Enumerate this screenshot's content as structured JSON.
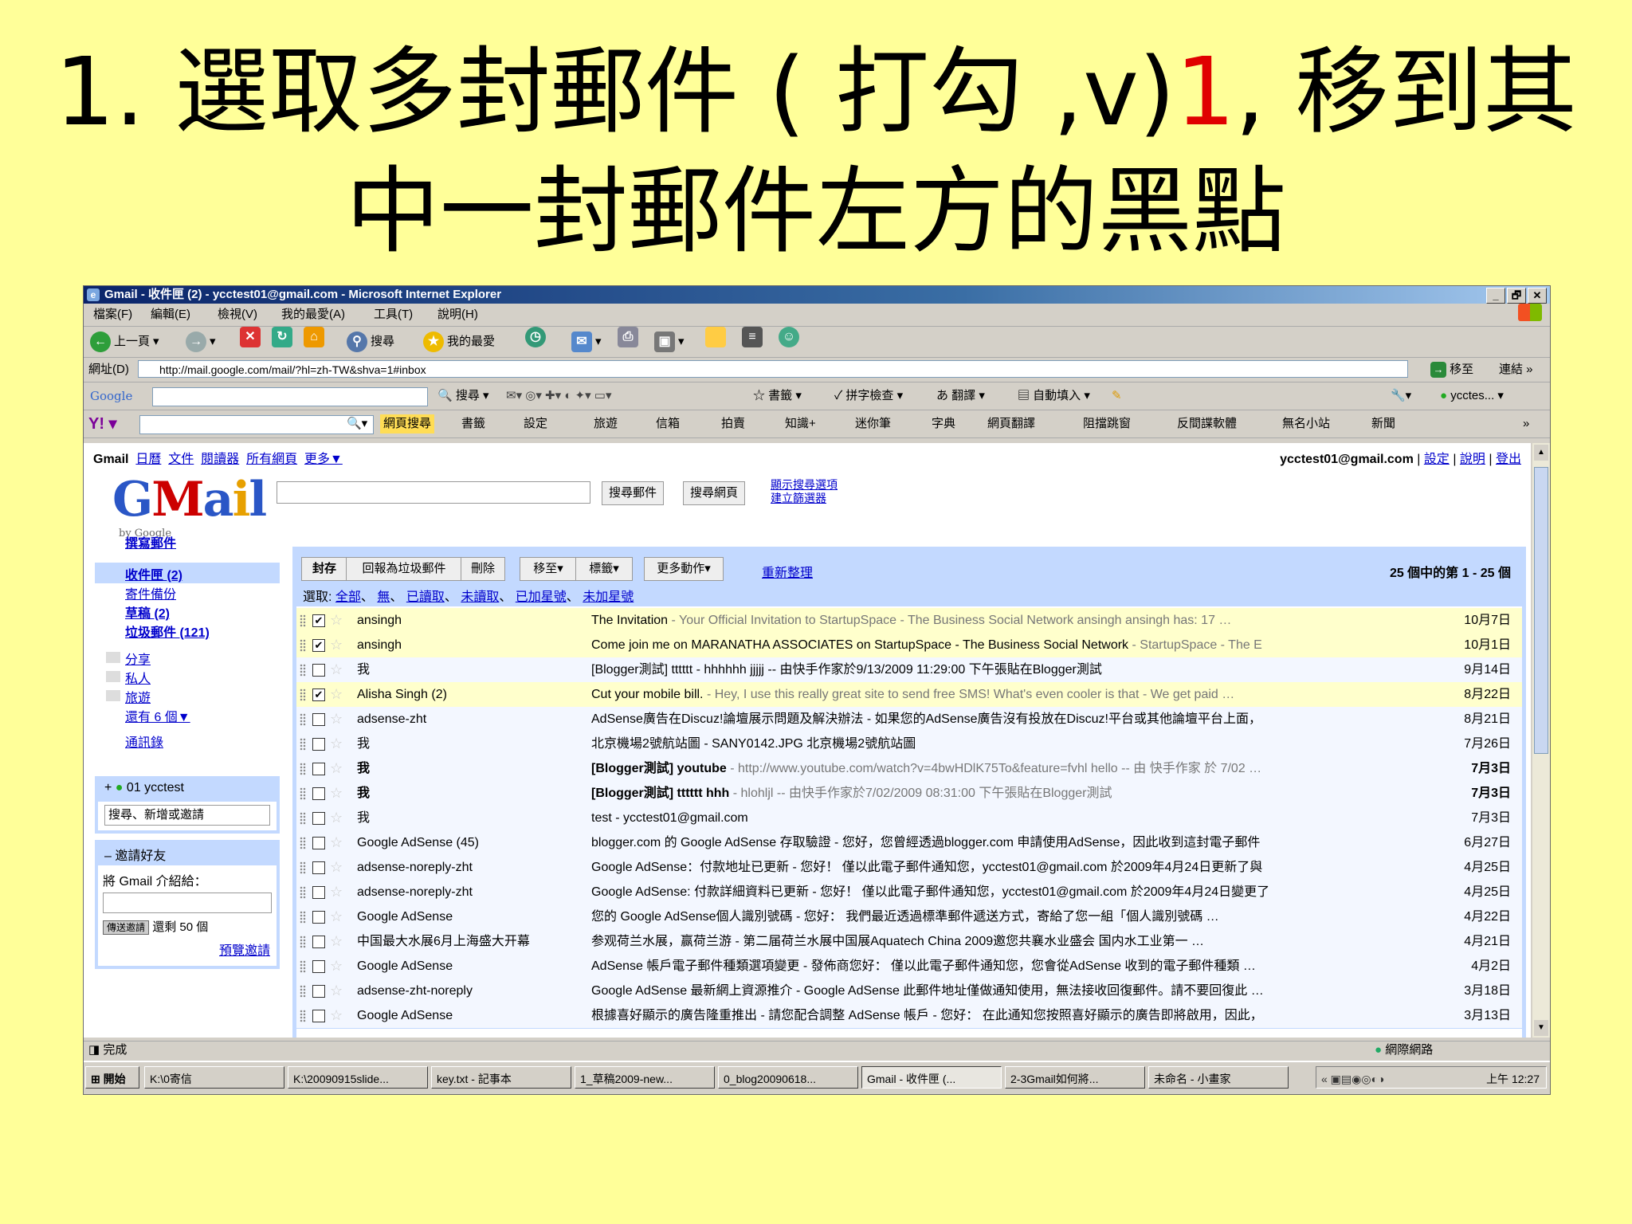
{
  "slide": {
    "title_line1_a": "1. 選取多封郵件 ( 打勾 ,v)",
    "title_line1_num": "1",
    "title_line1_b": ", 移到其",
    "title_line2": "中一封郵件左方的黑點"
  },
  "window": {
    "title": "Gmail - 收件匣 (2) - ycctest01@gmail.com - Microsoft Internet Explorer",
    "controls": [
      "_",
      "🗗",
      "✕"
    ]
  },
  "menu": [
    "檔案(F)",
    "編輯(E)",
    "檢視(V)",
    "我的最愛(A)",
    "工具(T)",
    "說明(H)"
  ],
  "toolbar": {
    "back": "上一頁",
    "search": "搜尋",
    "favorites": "我的最愛"
  },
  "address": {
    "label": "網址(D)",
    "url": "http://mail.google.com/mail/?hl=zh-TW&shva=1#inbox",
    "go": "移至",
    "links": "連結"
  },
  "google_toolbar": {
    "logo": "Google",
    "items": [
      "搜尋",
      "書籤",
      "拼字檢查",
      "翻譯",
      "自動填入"
    ],
    "account": "ycctes..."
  },
  "yahoo_toolbar": {
    "logo": "Y!",
    "items": [
      "網頁搜尋",
      "書籤",
      "設定",
      "旅遊",
      "信箱",
      "拍賣",
      "知識+",
      "迷你筆",
      "字典",
      "網頁翻譯",
      "阻擋跳窗",
      "反間諜軟體",
      "無名小站",
      "新聞"
    ]
  },
  "gmail": {
    "topnav": [
      "Gmail",
      "日曆",
      "文件",
      "閱讀器",
      "所有網頁",
      "更多▼"
    ],
    "account": "ycctest01@gmail.com",
    "account_links": [
      "設定",
      "說明",
      "登出"
    ],
    "logo": "Gmail",
    "logo_sub": "by Google",
    "search_mail_btn": "搜尋郵件",
    "search_web_btn": "搜尋網頁",
    "show_options": "顯示搜尋選項",
    "create_filter": "建立篩選器",
    "compose": "撰寫郵件",
    "nav": [
      "收件匣 (2)",
      "寄件備份",
      "草稿 (2)",
      "垃圾郵件 (121)"
    ],
    "labels": [
      "分享",
      "私人",
      "旅遊",
      "還有 6 個▼"
    ],
    "contacts": "通訊錄",
    "chat_user": "01 ycctest",
    "chat_search": "搜尋、新增或邀請",
    "invite_header": "邀請好友",
    "invite_text": "將 Gmail 介紹給：",
    "invite_btn": "傳送邀請",
    "invite_left": "還剩 50 個",
    "invite_preview": "預覽邀請",
    "actions": [
      "封存",
      "回報為垃圾郵件",
      "刪除",
      "移至▾",
      "標籤▾",
      "更多動作▾"
    ],
    "refresh": "重新整理",
    "count": "25 個中的第 1 - 25 個",
    "select_label": "選取:",
    "select_options": [
      "全部",
      "無",
      "已讀取",
      "未讀取",
      "已加星號",
      "未加星號"
    ],
    "rows": [
      {
        "checked": true,
        "unread": false,
        "sender": "ansingh",
        "subject": "The Invitation",
        "snippet": " - Your Official Invitation to StartupSpace - The Business Social Network ansingh ansingh has: 17 …",
        "date": "10月7日"
      },
      {
        "checked": true,
        "unread": false,
        "sender": "ansingh",
        "subject": "Come join me on MARANATHA ASSOCIATES on StartupSpace - The Business Social Network",
        "snippet": " - StartupSpace - The E",
        "date": "10月1日"
      },
      {
        "checked": false,
        "unread": false,
        "sender": "我",
        "subject": "",
        "snippet": "[Blogger測試] tttttt - hhhhhh jjjjj -- 由快手作家於9/13/2009 11:29:00 下午張貼在Blogger測試",
        "date": "9月14日"
      },
      {
        "checked": true,
        "unread": false,
        "sender": "Alisha Singh (2)",
        "subject": "Cut your mobile bill.",
        "snippet": " - Hey, I use this really great site to send free SMS! What's even cooler is that - We get paid …",
        "date": "8月22日"
      },
      {
        "checked": false,
        "unread": false,
        "sender": "adsense-zht",
        "subject": "",
        "snippet": "AdSense廣告在Discuz!論壇展示問題及解決辦法 - 如果您的AdSense廣告沒有投放在Discuz!平台或其他論壇平台上面，",
        "date": "8月21日"
      },
      {
        "checked": false,
        "unread": false,
        "sender": "我",
        "subject": "",
        "snippet": "北京機場2號航站圖 - SANY0142.JPG 北京機場2號航站圖",
        "date": "7月26日"
      },
      {
        "checked": false,
        "unread": true,
        "sender": "我",
        "subject": "[Blogger測試] youtube",
        "snippet": " - http://www.youtube.com/watch?v=4bwHDlK75To&feature=fvhl hello -- 由 快手作家 於 7/02 …",
        "date": "7月3日"
      },
      {
        "checked": false,
        "unread": true,
        "sender": "我",
        "subject": "[Blogger測試] tttttt hhh",
        "snippet": " - hlohljl -- 由快手作家於7/02/2009 08:31:00 下午張貼在Blogger測試",
        "date": "7月3日"
      },
      {
        "checked": false,
        "unread": false,
        "sender": "我",
        "subject": "",
        "snippet": "test - ycctest01@gmail.com",
        "date": "7月3日"
      },
      {
        "checked": false,
        "unread": false,
        "sender": "Google AdSense (45)",
        "subject": "",
        "snippet": "blogger.com 的 Google AdSense 存取驗證 - 您好，您曾經透過blogger.com 申請使用AdSense，因此收到這封電子郵件",
        "date": "6月27日"
      },
      {
        "checked": false,
        "unread": false,
        "sender": "adsense-noreply-zht",
        "subject": "",
        "snippet": "Google AdSense：付款地址已更新 - 您好！ 僅以此電子郵件通知您，ycctest01@gmail.com 於2009年4月24日更新了與",
        "date": "4月25日"
      },
      {
        "checked": false,
        "unread": false,
        "sender": "adsense-noreply-zht",
        "subject": "",
        "snippet": "Google AdSense: 付款詳細資料已更新 - 您好！ 僅以此電子郵件通知您，ycctest01@gmail.com 於2009年4月24日變更了",
        "date": "4月25日"
      },
      {
        "checked": false,
        "unread": false,
        "sender": "Google AdSense",
        "subject": "",
        "snippet": "您的 Google AdSense個人識別號碼 - 您好： 我們最近透過標準郵件遞送方式，寄給了您一組「個人識別號碼 …",
        "date": "4月22日"
      },
      {
        "checked": false,
        "unread": false,
        "sender": "中国最大水展6月上海盛大开幕",
        "subject": "",
        "snippet": "参观荷兰水展，赢荷兰游 - 第二届荷兰水展中国展Aquatech China 2009邀您共襄水业盛会 国内水工业第一 …",
        "date": "4月21日"
      },
      {
        "checked": false,
        "unread": false,
        "sender": "Google AdSense",
        "subject": "",
        "snippet": "AdSense 帳戶電子郵件種類選項變更 - 發佈商您好： 僅以此電子郵件通知您，您會從AdSense 收到的電子郵件種類 …",
        "date": "4月2日"
      },
      {
        "checked": false,
        "unread": false,
        "sender": "adsense-zht-noreply",
        "subject": "",
        "snippet": "Google AdSense 最新網上資源推介 - Google AdSense 此郵件地址僅做通知使用，無法接收回復郵件。請不要回復此 …",
        "date": "3月18日"
      },
      {
        "checked": false,
        "unread": false,
        "sender": "Google AdSense",
        "subject": "",
        "snippet": "根據喜好顯示的廣告隆重推出 - 請您配合調整 AdSense 帳戶 - 您好： 在此通知您按照喜好顯示的廣告即將啟用，因此，",
        "date": "3月13日"
      }
    ]
  },
  "status": {
    "left": "完成",
    "right": "網際網路"
  },
  "taskbar": {
    "start": "開始",
    "buttons": [
      "K:\\0寄信",
      "K:\\20090915slide...",
      "key.txt - 記事本",
      "1_草稿2009-new...",
      "0_blog20090618...",
      "Gmail - 收件匣 (...",
      "2-3Gmail如何將...",
      "未命名 - 小畫家"
    ],
    "clock": "上午 12:27"
  }
}
